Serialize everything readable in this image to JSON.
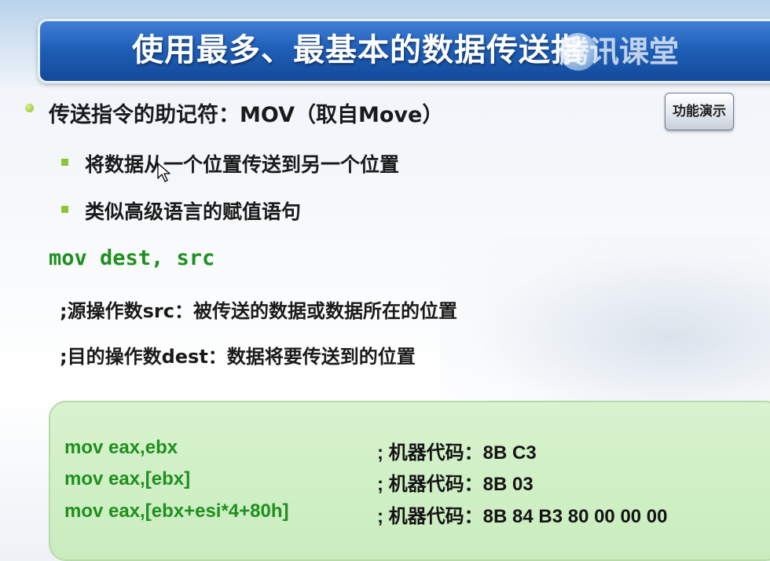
{
  "slide": {
    "title": "使用最多、最基本的数据传送指",
    "watermark": "腾讯课堂",
    "demo_button": "功能演示",
    "bullets": {
      "main": "传送指令的助记符：MOV（取自Move）",
      "sub1": "将数据从一个位置传送到另一个位置",
      "sub2": "类似高级语言的赋值语句"
    },
    "syntax": "mov dest, src",
    "notes": {
      "src": ";源操作数src：被传送的数据或数据所在的位置",
      "dest": ";目的操作数dest：数据将要传送到的位置"
    },
    "code_examples": [
      {
        "instr": "mov eax,ebx",
        "comment": "; 机器代码：8B C3"
      },
      {
        "instr": "mov eax,[ebx]",
        "comment": "; 机器代码：8B 03"
      },
      {
        "instr": "mov eax,[ebx+esi*4+80h]",
        "comment": "; 机器代码：8B 84 B3 80 00 00 00"
      }
    ]
  },
  "colors": {
    "title_bar": "#1f5fb8",
    "code_box_bg": "#d8f3cf",
    "code_green": "#1f8f1f",
    "bullet_green": "#8cc43a"
  }
}
